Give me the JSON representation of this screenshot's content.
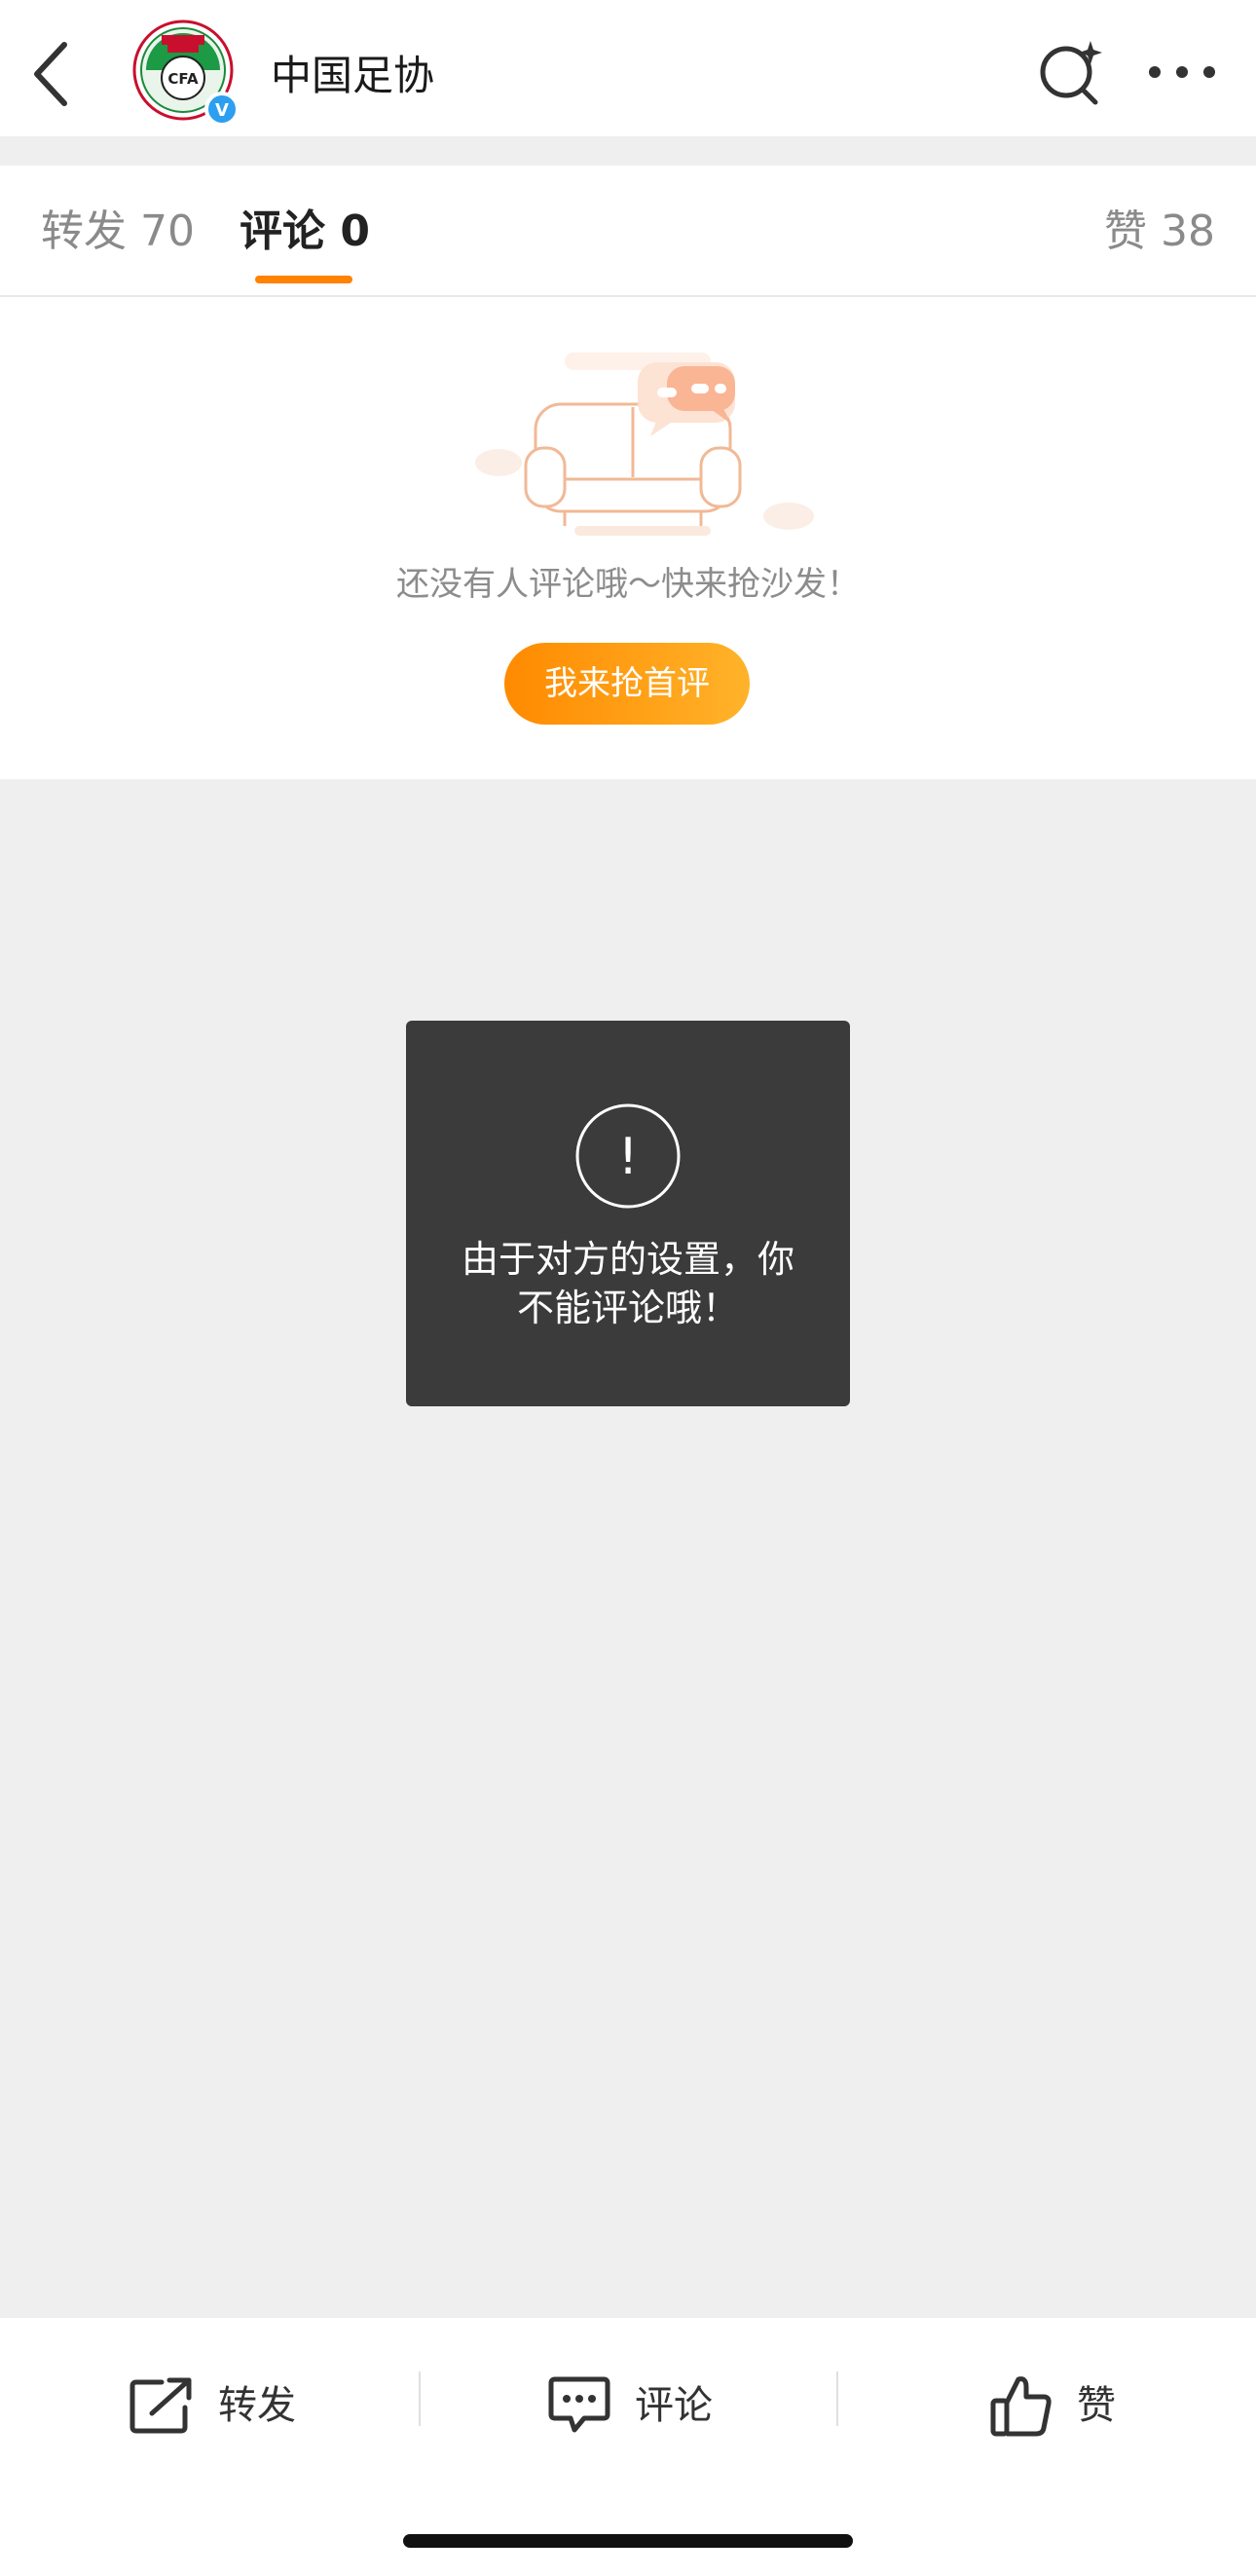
{
  "header": {
    "account_name": "中国足协",
    "avatar_text": "CFA",
    "verified_mark": "V"
  },
  "tabs": {
    "repost_label": "转发 70",
    "comment_label": "评论 0",
    "like_label": "赞 38"
  },
  "empty_state": {
    "message": "还没有人评论哦～快来抢沙发！",
    "button_label": "我来抢首评"
  },
  "toast": {
    "icon_glyph": "!",
    "message_line1": "由于对方的设置，你",
    "message_line2": "不能评论哦！"
  },
  "bottom_bar": {
    "repost_label": "转发",
    "comment_label": "评论",
    "like_label": "赞"
  },
  "colors": {
    "accent": "#ff8200",
    "toast_bg": "#3b3b3b",
    "verified": "#2d9ff0"
  },
  "icons": [
    "back-arrow-icon",
    "search-sparkle-icon",
    "more-dots-icon",
    "sofa-icon",
    "exclamation-icon",
    "share-icon",
    "comment-icon",
    "thumbs-up-icon"
  ]
}
